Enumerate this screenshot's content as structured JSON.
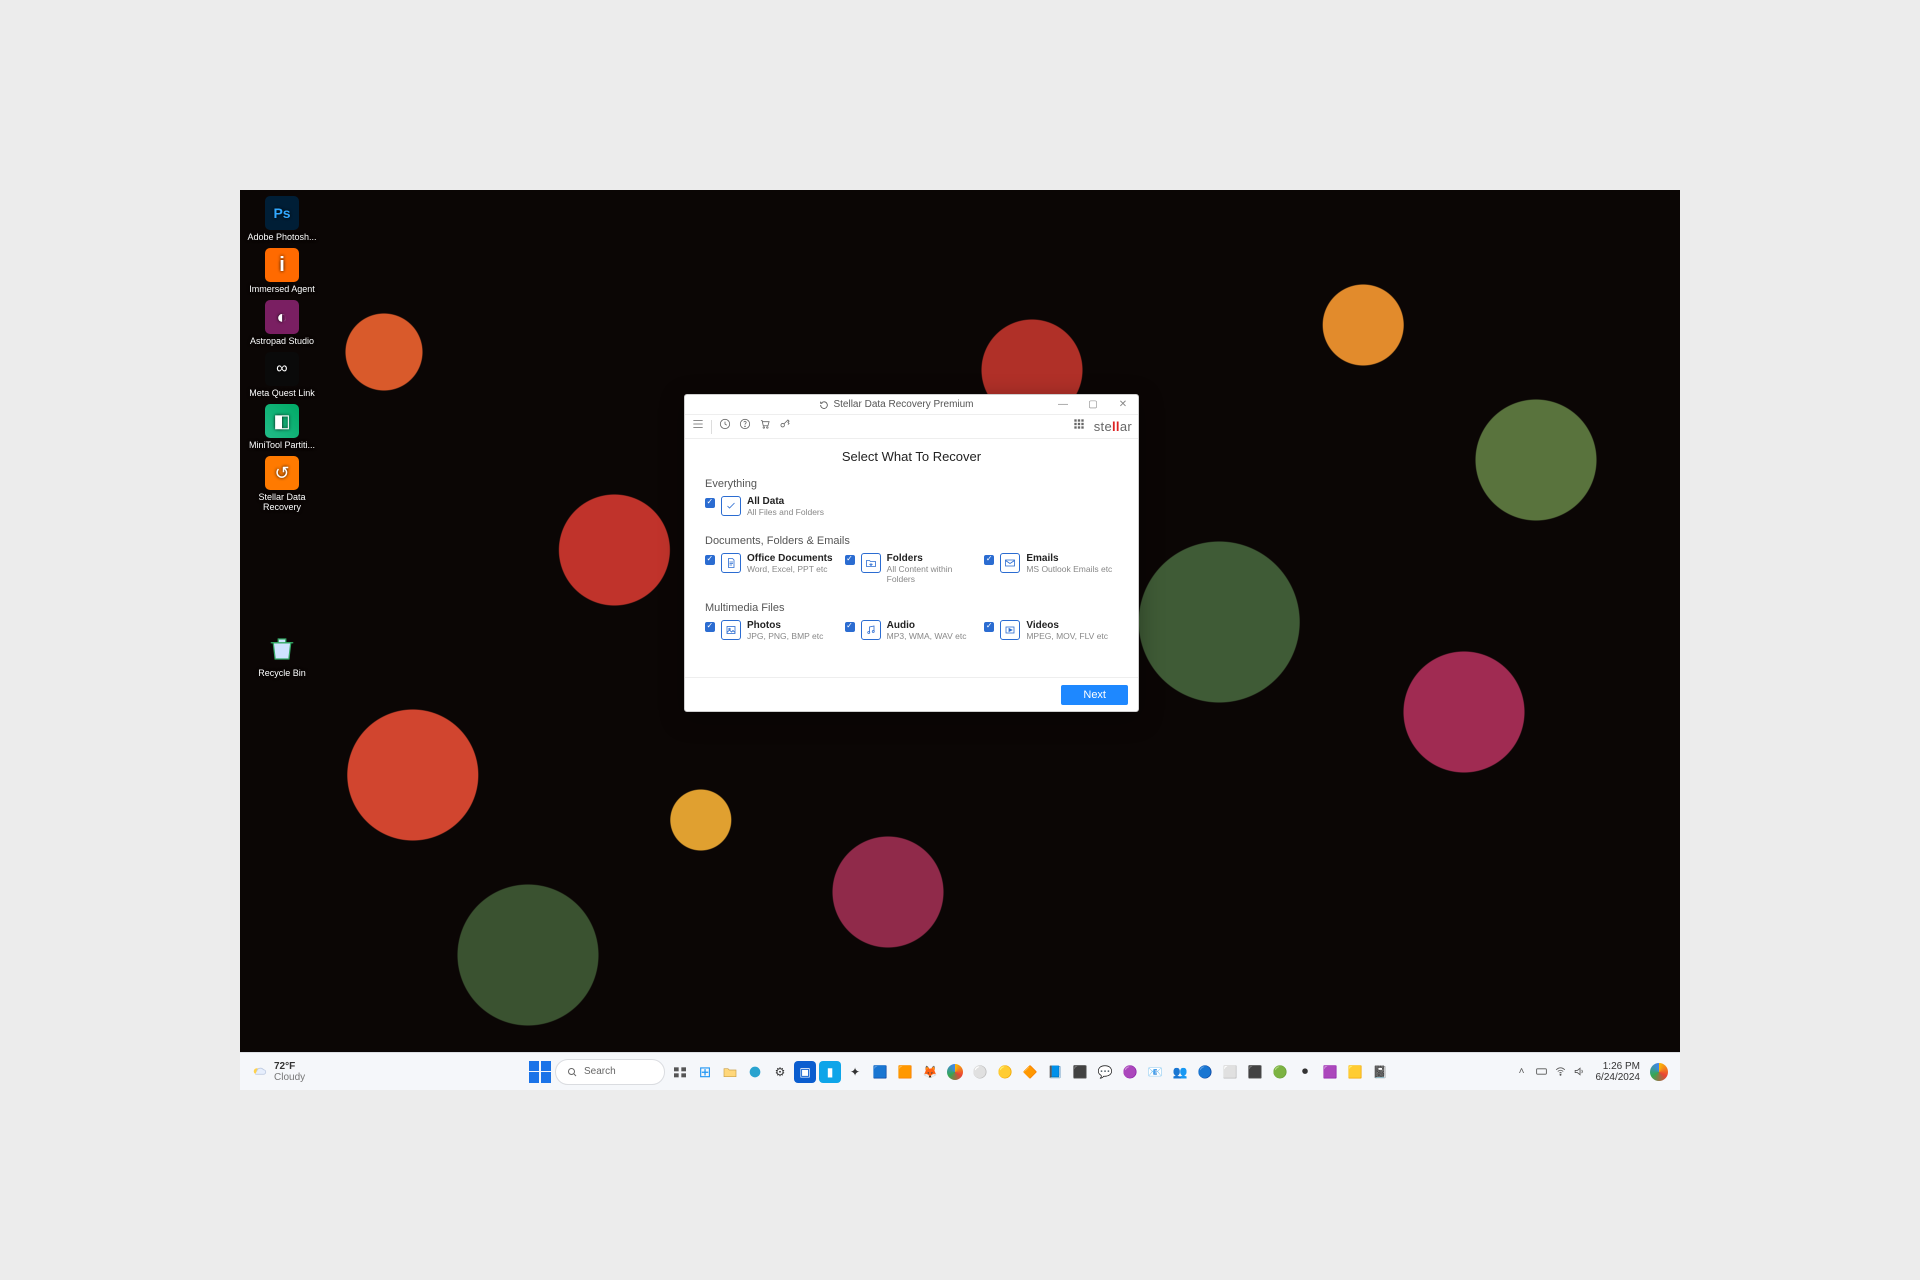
{
  "desktop_icons": {
    "adobe_photoshop": "Adobe Photosh...",
    "immersed_agent": "Immersed Agent",
    "astropad_studio": "Astropad Studio",
    "meta_quest_link": "Meta Quest Link",
    "minitool_partition": "MiniTool Partiti...",
    "stellar_data_recovery": "Stellar Data Recovery",
    "recycle_bin": "Recycle Bin"
  },
  "app": {
    "window_title": "Stellar Data Recovery Premium",
    "brand_prefix": "ste",
    "brand_mid": "ll",
    "brand_suffix": "ar",
    "heading": "Select What To Recover",
    "sections": {
      "everything": {
        "title": "Everything",
        "all_data": {
          "title": "All Data",
          "sub": "All Files and Folders"
        }
      },
      "dfe": {
        "title": "Documents, Folders & Emails",
        "office": {
          "title": "Office Documents",
          "sub": "Word, Excel, PPT etc"
        },
        "folders": {
          "title": "Folders",
          "sub": "All Content within Folders"
        },
        "emails": {
          "title": "Emails",
          "sub": "MS Outlook Emails etc"
        }
      },
      "multimedia": {
        "title": "Multimedia Files",
        "photos": {
          "title": "Photos",
          "sub": "JPG, PNG, BMP etc"
        },
        "audio": {
          "title": "Audio",
          "sub": "MP3, WMA, WAV etc"
        },
        "videos": {
          "title": "Videos",
          "sub": "MPEG, MOV, FLV etc"
        }
      }
    },
    "next_button": "Next"
  },
  "taskbar": {
    "weather_temp": "72°F",
    "weather_cond": "Cloudy",
    "search_placeholder": "Search",
    "time": "1:26 PM",
    "date": "6/24/2024"
  }
}
